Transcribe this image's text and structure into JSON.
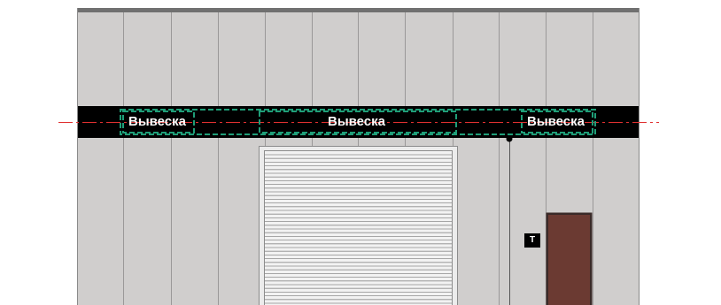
{
  "colors": {
    "background": "#ffffff",
    "wall_panel": "#d0cecd",
    "panel_seam": "#9a9898",
    "roof_edge": "#707070",
    "sign_band": "#000000",
    "sign_frame": "#1f9e78",
    "axis_line": "#e03030",
    "shutter_slats": "#f2f2f2",
    "shutter_lines": "#8c8c8c",
    "door_fill": "#6b3a32",
    "door_frame": "#3a2a28"
  },
  "signs": [
    {
      "label": "Вывеска"
    },
    {
      "label": "Вывеска"
    },
    {
      "label": "Вывеска"
    }
  ],
  "marker": {
    "label": "Т"
  },
  "icons": {
    "axis": "centerline-dash-dot",
    "pipe": "drain-pipe",
    "point": "anchor-dot"
  }
}
